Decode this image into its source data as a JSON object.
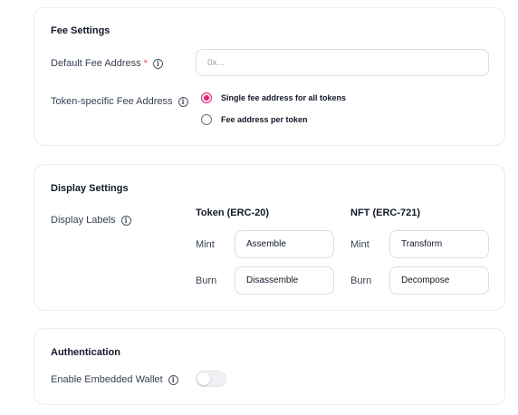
{
  "fee_settings": {
    "title": "Fee Settings",
    "default_fee_label": "Default Fee Address",
    "required_mark": "*",
    "default_fee_placeholder": "0x...",
    "token_fee_label": "Token-specific Fee Address",
    "options": [
      {
        "label": "Single fee address for all tokens",
        "selected": true
      },
      {
        "label": "Fee address per token",
        "selected": false
      }
    ]
  },
  "display_settings": {
    "title": "Display Settings",
    "display_labels_label": "Display Labels",
    "token": {
      "heading": "Token (ERC-20)",
      "mint_label": "Mint",
      "mint_value": "Assemble",
      "burn_label": "Burn",
      "burn_value": "Disassemble"
    },
    "nft": {
      "heading": "NFT (ERC-721)",
      "mint_label": "Mint",
      "mint_value": "Transform",
      "burn_label": "Burn",
      "burn_value": "Decompose"
    }
  },
  "authentication": {
    "title": "Authentication",
    "embedded_wallet_label": "Enable Embedded Wallet",
    "embedded_wallet_enabled": false
  },
  "icons": {
    "info": "info-icon"
  },
  "colors": {
    "accent": "#e0267a",
    "required": "#e5484d"
  }
}
